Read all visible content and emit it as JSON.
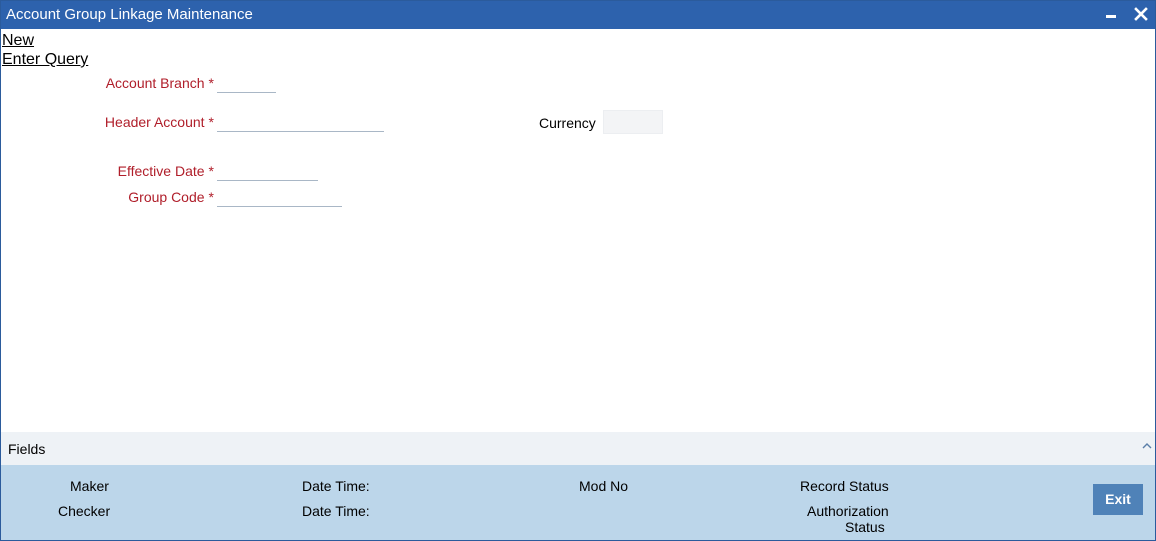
{
  "window": {
    "title": "Account Group Linkage Maintenance",
    "minimize_icon": "minimize-icon",
    "close_icon": "close-icon"
  },
  "toolbar": {
    "new_label": "New",
    "enter_query_label": "Enter Query"
  },
  "form": {
    "account_branch": {
      "label": "Account Branch",
      "required": "*",
      "value": ""
    },
    "header_account": {
      "label": "Header Account",
      "required": "*",
      "value": ""
    },
    "currency": {
      "label": "Currency",
      "value": ""
    },
    "effective_date": {
      "label": "Effective Date",
      "required": "*",
      "value": ""
    },
    "group_code": {
      "label": "Group Code",
      "required": "*",
      "value": ""
    }
  },
  "fields_section": {
    "label": "Fields",
    "toggle_icon": "chevron-up-icon"
  },
  "audit": {
    "maker": "Maker",
    "maker_datetime": "Date Time:",
    "checker": "Checker",
    "checker_datetime": "Date Time:",
    "mod_no": "Mod No",
    "record_status": "Record Status",
    "authorization_status_line1": "Authorization",
    "authorization_status_line2": "Status",
    "exit_label": "Exit"
  },
  "colors": {
    "titlebar": "#2d62ad",
    "required_label": "#b01e2a",
    "audit_panel": "#bcd6ea",
    "exit_button": "#4f82b8"
  }
}
